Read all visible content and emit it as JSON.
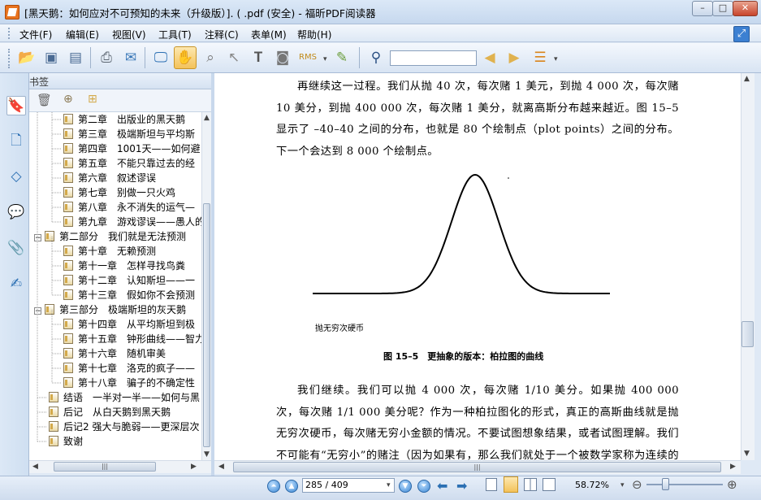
{
  "window": {
    "title": "[黑天鹅：如何应对不可预知的未来（升级版）]. ( .pdf (安全) - 福昕PDF阅读器",
    "controls": {
      "minimize": "–",
      "maximize": "□",
      "close": "✕"
    }
  },
  "menu": {
    "items": [
      "文件(F)",
      "编辑(E)",
      "视图(V)",
      "工具(T)",
      "注释(C)",
      "表单(M)",
      "帮助(H)"
    ]
  },
  "toolbar": {
    "icons": [
      "open-icon",
      "save-icon",
      "save-as-icon",
      "print-icon",
      "email-icon",
      "fullscreen-icon",
      "hand-tool-icon",
      "zoom-tool-icon",
      "select-tool-icon",
      "text-select-icon",
      "snapshot-icon",
      "rms-icon",
      "sign-icon",
      "find-icon"
    ],
    "search_value": ""
  },
  "bookmarks": {
    "title": "书签",
    "items": [
      {
        "label": "第二章　出版业的黑天鹅",
        "level": 2
      },
      {
        "label": "第三章　极端斯坦与平均斯",
        "level": 2
      },
      {
        "label": "第四章　1001天——如何避",
        "level": 2
      },
      {
        "label": "第五章　不能只靠过去的经",
        "level": 2
      },
      {
        "label": "第六章　叙述谬误",
        "level": 2
      },
      {
        "label": "第七章　别做一只火鸡",
        "level": 2
      },
      {
        "label": "第八章　永不消失的运气—",
        "level": 2
      },
      {
        "label": "第九章　游戏谬误——愚人的",
        "level": 2
      },
      {
        "label": "第二部分　我们就是无法预测",
        "level": 1,
        "collapse": "−"
      },
      {
        "label": "第十章　无赖预测",
        "level": 2
      },
      {
        "label": "第十一章　怎样寻找鸟粪",
        "level": 2
      },
      {
        "label": "第十二章　认知斯坦——一",
        "level": 2
      },
      {
        "label": "第十三章　假如你不会预测",
        "level": 2
      },
      {
        "label": "第三部分　极端斯坦的灰天鹅",
        "level": 1,
        "collapse": "−"
      },
      {
        "label": "第十四章　从平均斯坦到极",
        "level": 2
      },
      {
        "label": "第十五章　钟形曲线——智力",
        "level": 2
      },
      {
        "label": "第十六章　随机审美",
        "level": 2
      },
      {
        "label": "第十七章　洛克的疯子——",
        "level": 2
      },
      {
        "label": "第十八章　骗子的不确定性",
        "level": 2
      },
      {
        "label": "结语　一半对一半——如何与黑",
        "level": 1
      },
      {
        "label": "后记　从白天鹅到黑天鹅",
        "level": 1
      },
      {
        "label": "后记2 强大与脆弱——更深层次",
        "level": 1
      },
      {
        "label": "致谢",
        "level": 1
      }
    ]
  },
  "document": {
    "para1": "再继续这一过程。我们从抛 40 次，每次赌 1 美元，到抛 4 000 次，每次赌 10 美分，到抛 400 000 次，每次赌 1 美分，就离高斯分布越来越近。图 15–5 显示了 –40–40 之间的分布，也就是 80 个绘制点（plot points）之间的分布。下一个会达到 8 000 个绘制点。",
    "figure_axis_label": "抛无穷次硬币",
    "figure_caption": "图 15–5　更抽象的版本：柏拉图的曲线",
    "para2": "我们继续。我们可以抛 4 000 次，每次赌 1/10 美分。如果抛 400 000 次，每次赌 1/1 000 美分呢？作为一种柏拉图化的形式，真正的高斯曲线就是抛无穷次硬币，每次赌无穷小金额的情况。不要试图想象结果，或者试图理解。我们不可能有“无穷小”的赌注（因为如果有，那么我们就处于一个被数学家称为连续的框"
  },
  "status": {
    "page_field": "285 / 409",
    "zoom": "58.72%",
    "zoom_level": 0.25
  }
}
